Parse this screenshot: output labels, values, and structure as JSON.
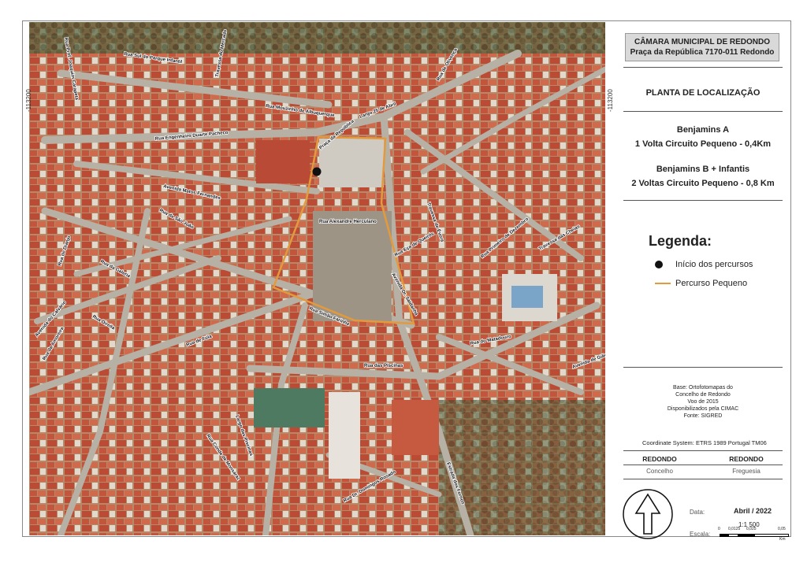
{
  "map": {
    "coord_left": "-113200",
    "coord_right": "-113200",
    "streets": [
      "Rua Prof. Joaquim Carapeta",
      "Rua Sul do Parque Infantil",
      "Travessa do Mercado",
      "Rua Mouzinho de Albuquerque",
      "Rua Engenheiro Duarte Pacheco",
      "Avenida Matos Fernandes",
      "Rua de São João",
      "Rua de Dianjo",
      "Rua da Galeria",
      "Rua Direita",
      "Rua de Fúla",
      "Rua da Amoreira",
      "Avenida do Calvário",
      "Rua Alexandre Herculano",
      "Rua Simão Farinha",
      "Rua Eça de Queirós",
      "Avenida Dr. Saldanha",
      "Praça da República",
      "Largo 25 de Abril",
      "Rua das Piscinas",
      "Rua do Matadouro",
      "Rua Primeiro de Dezembro",
      "Travessa das Cheias",
      "Avenida de Gião",
      "Rua Dr. Domingos Rosado",
      "Estrada dos Fornos",
      "Largo das Piscinas",
      "Rua Conde de Monsaraz",
      "Travessa de Évora",
      "Rua de Olivença"
    ]
  },
  "panel": {
    "org_line1": "CÂMARA MUNICIPAL DE REDONDO",
    "org_line2": "Praça da República 7170-011 Redondo",
    "plan_title": "PLANTA DE LOCALIZAÇÃO",
    "route_a_title": "Benjamins A",
    "route_a_desc": "1 Volta Circuito Pequeno - 0,4Km",
    "route_b_title": "Benjamins B + Infantis",
    "route_b_desc": "2 Voltas Circuito Pequeno - 0,8 Km",
    "legend_title": "Legenda:",
    "legend_start": "Início dos percursos",
    "legend_route": "Percurso Pequeno",
    "route_color": "#e39a3c",
    "base_1": "Base: Ortofotomapas do",
    "base_2": "Concelho de Redondo",
    "base_3": "Voo de 2015",
    "base_4": "Disponibilizados pela CIMAC",
    "base_5": "Fonte: SIGRED",
    "coord_system": "Coordinate System: ETRS 1989 Portugal TM06",
    "left_admin_name": "REDONDO",
    "left_admin_type": "Concelho",
    "right_admin_name": "REDONDO",
    "right_admin_type": "Freguesia",
    "date_label": "Data:",
    "date_value": "Abril / 2022",
    "scale_ratio": "1:1 500",
    "scale_label": "Escala:",
    "scale_ticks": [
      "0",
      "0,0125",
      "0,025",
      "0,05"
    ],
    "scale_unit": "Km"
  }
}
